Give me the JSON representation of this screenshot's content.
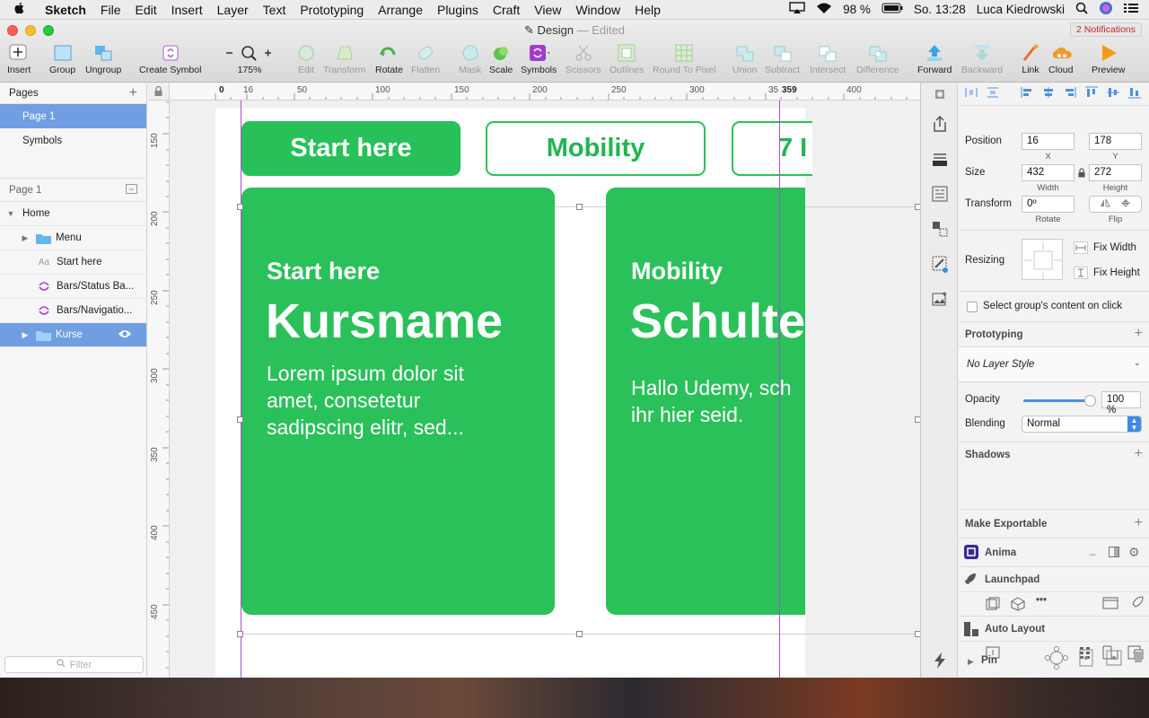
{
  "menubar": {
    "app": "Sketch",
    "items": [
      "File",
      "Edit",
      "Insert",
      "Layer",
      "Text",
      "Prototyping",
      "Arrange",
      "Plugins",
      "Craft",
      "View",
      "Window",
      "Help"
    ],
    "battery": "98 %",
    "datetime": "So. 13:28",
    "user": "Luca Kiedrowski"
  },
  "window": {
    "title": "Design",
    "edited": "— Edited",
    "notifications": "2 Notifications"
  },
  "toolbar": {
    "insert": "Insert",
    "group": "Group",
    "ungroup": "Ungroup",
    "create_symbol": "Create Symbol",
    "zoom": "175%",
    "edit": "Edit",
    "transform": "Transform",
    "rotate": "Rotate",
    "flatten": "Flatten",
    "mask": "Mask",
    "scale": "Scale",
    "symbols": "Symbols",
    "scissors": "Scissors",
    "outlines": "Outlines",
    "round": "Round To Pixel",
    "union": "Union",
    "subtract": "Subtract",
    "intersect": "Intersect",
    "difference": "Difference",
    "forward": "Forward",
    "backward": "Backward",
    "link": "Link",
    "cloud": "Cloud",
    "preview": "Preview"
  },
  "sidebar": {
    "pages_title": "Pages",
    "pages": [
      "Page 1",
      "Symbols"
    ],
    "page_header": "Page 1",
    "layers": [
      {
        "name": "Home",
        "indent": 0
      },
      {
        "name": "Menu",
        "indent": 1
      },
      {
        "name": "Start here",
        "indent": 1
      },
      {
        "name": "Bars/Status Ba...",
        "indent": 1
      },
      {
        "name": "Bars/Navigatio...",
        "indent": 1
      },
      {
        "name": "Kurse",
        "indent": 1
      }
    ],
    "filter_placeholder": "Filter"
  },
  "rulers": {
    "top": [
      "0",
      "16",
      "50",
      "100",
      "150",
      "200",
      "250",
      "300",
      "35",
      "359",
      "400"
    ],
    "left": [
      "150",
      "200",
      "250",
      "300",
      "350",
      "400",
      "450"
    ]
  },
  "canvas": {
    "pills": [
      "Start here",
      "Mobility",
      "7 I"
    ],
    "cards": [
      {
        "subtitle": "Start here",
        "title": "Kursname",
        "body": "Lorem ipsum dolor sit\namet, consetetur\nsadipscing elitr, sed..."
      },
      {
        "subtitle": "Mobility",
        "title": "Schulte",
        "body": "Hallo Udemy, sch\nihr hier seid."
      }
    ],
    "green": "#2ac05a"
  },
  "inspector": {
    "position_label": "Position",
    "x": "16",
    "y": "178",
    "x_cap": "X",
    "y_cap": "Y",
    "size_label": "Size",
    "width": "432",
    "height": "272",
    "w_cap": "Width",
    "h_cap": "Height",
    "transform_label": "Transform",
    "rotate": "0º",
    "rotate_cap": "Rotate",
    "flip_cap": "Flip",
    "resizing_label": "Resizing",
    "fix_width": "Fix Width",
    "fix_height": "Fix Height",
    "select_group": "Select group's content on click",
    "prototyping": "Prototyping",
    "layer_style": "No Layer Style",
    "opacity_label": "Opacity",
    "opacity": "100 %",
    "opacity_value": 1.0,
    "blending_label": "Blending",
    "blending": "Normal",
    "shadows": "Shadows",
    "exportable": "Make Exportable",
    "anima": "Anima",
    "launchpad": "Launchpad",
    "auto_layout": "Auto Layout",
    "pin": "Pin"
  }
}
